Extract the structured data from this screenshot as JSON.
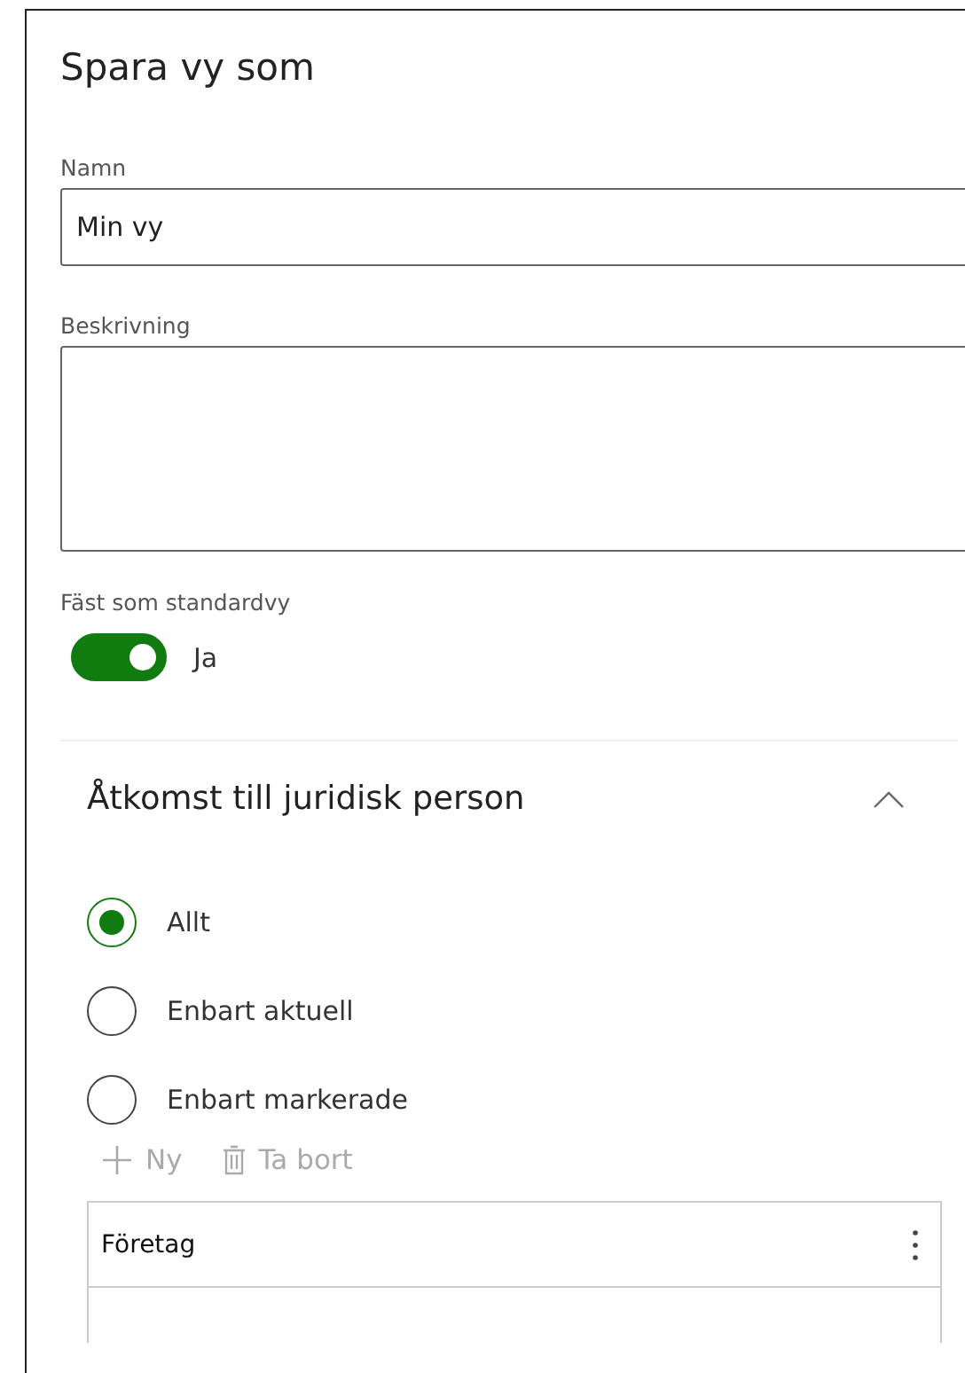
{
  "panel": {
    "title": "Spara vy som"
  },
  "name_field": {
    "label": "Namn",
    "value": "Min vy"
  },
  "description_field": {
    "label": "Beskrivning"
  },
  "pin_default": {
    "label": "Fäst som standardvy",
    "on": true,
    "state_text": "Ja"
  },
  "section": {
    "title": "Åtkomst till juridisk person",
    "expanded": true,
    "options": [
      {
        "label": "Allt",
        "selected": true
      },
      {
        "label": "Enbart aktuell",
        "selected": false
      },
      {
        "label": "Enbart markerade",
        "selected": false
      }
    ],
    "toolbar": [
      {
        "kind": "add",
        "label": "Ny",
        "disabled": true
      },
      {
        "kind": "delete",
        "label": "Ta bort",
        "disabled": true
      }
    ],
    "table": {
      "columns": [
        "Företag"
      ]
    }
  }
}
